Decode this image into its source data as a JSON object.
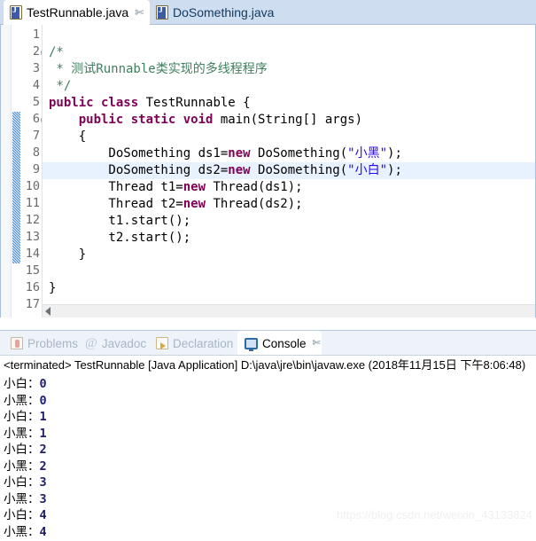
{
  "editor": {
    "tabs": [
      {
        "label": "TestRunnable.java",
        "icon": "java-file-icon",
        "active": true,
        "close": "✄"
      },
      {
        "label": "DoSomething.java",
        "icon": "java-file-icon",
        "active": false,
        "close": ""
      }
    ],
    "close_glyph": "✄",
    "lines": [
      {
        "no": "1",
        "fold": false,
        "changed": false,
        "current": false,
        "segments": []
      },
      {
        "no": "2",
        "fold": true,
        "changed": false,
        "current": false,
        "segments": [
          {
            "t": "/*",
            "c": "cmt"
          }
        ]
      },
      {
        "no": "3",
        "fold": false,
        "changed": false,
        "current": false,
        "segments": [
          {
            "t": " * 测试Runnable类实现的多线程程序",
            "c": "cmt"
          }
        ]
      },
      {
        "no": "4",
        "fold": false,
        "changed": false,
        "current": false,
        "segments": [
          {
            "t": " */",
            "c": "cmt"
          }
        ]
      },
      {
        "no": "5",
        "fold": false,
        "changed": false,
        "current": false,
        "segments": [
          {
            "t": "public class",
            "c": "kw"
          },
          {
            "t": " TestRunnable {",
            "c": ""
          }
        ]
      },
      {
        "no": "6",
        "fold": true,
        "changed": true,
        "current": false,
        "segments": [
          {
            "t": "    ",
            "c": ""
          },
          {
            "t": "public static void",
            "c": "kw"
          },
          {
            "t": " main(String[] args)",
            "c": ""
          }
        ]
      },
      {
        "no": "7",
        "fold": false,
        "changed": true,
        "current": false,
        "segments": [
          {
            "t": "    {",
            "c": ""
          }
        ]
      },
      {
        "no": "8",
        "fold": false,
        "changed": true,
        "current": false,
        "segments": [
          {
            "t": "        DoSomething ds1=",
            "c": ""
          },
          {
            "t": "new",
            "c": "kw"
          },
          {
            "t": " DoSomething(",
            "c": ""
          },
          {
            "t": "\"小黑\"",
            "c": "str"
          },
          {
            "t": ");",
            "c": ""
          }
        ]
      },
      {
        "no": "9",
        "fold": false,
        "changed": true,
        "current": true,
        "segments": [
          {
            "t": "        DoSomething ds2=",
            "c": ""
          },
          {
            "t": "new",
            "c": "kw"
          },
          {
            "t": " DoSomething(",
            "c": ""
          },
          {
            "t": "\"小白\"",
            "c": "str"
          },
          {
            "t": ");",
            "c": ""
          }
        ]
      },
      {
        "no": "10",
        "fold": false,
        "changed": true,
        "current": false,
        "segments": [
          {
            "t": "        Thread t1=",
            "c": ""
          },
          {
            "t": "new",
            "c": "kw"
          },
          {
            "t": " Thread(ds1);",
            "c": ""
          }
        ]
      },
      {
        "no": "11",
        "fold": false,
        "changed": true,
        "current": false,
        "segments": [
          {
            "t": "        Thread t2=",
            "c": ""
          },
          {
            "t": "new",
            "c": "kw"
          },
          {
            "t": " Thread(ds2);",
            "c": ""
          }
        ]
      },
      {
        "no": "12",
        "fold": false,
        "changed": true,
        "current": false,
        "segments": [
          {
            "t": "        t1.start();",
            "c": ""
          }
        ]
      },
      {
        "no": "13",
        "fold": false,
        "changed": true,
        "current": false,
        "segments": [
          {
            "t": "        t2.start();",
            "c": ""
          }
        ]
      },
      {
        "no": "14",
        "fold": false,
        "changed": true,
        "current": false,
        "segments": [
          {
            "t": "    }",
            "c": ""
          }
        ]
      },
      {
        "no": "15",
        "fold": false,
        "changed": false,
        "current": false,
        "segments": []
      },
      {
        "no": "16",
        "fold": false,
        "changed": false,
        "current": false,
        "segments": [
          {
            "t": "}",
            "c": ""
          }
        ]
      },
      {
        "no": "17",
        "fold": false,
        "changed": false,
        "current": false,
        "segments": []
      }
    ]
  },
  "views": {
    "tabs": [
      {
        "label": "Problems",
        "icon": "problems-icon",
        "active": false
      },
      {
        "label": "Javadoc",
        "icon": "javadoc-icon",
        "active": false
      },
      {
        "label": "Declaration",
        "icon": "declaration-icon",
        "active": false
      },
      {
        "label": "Console",
        "icon": "console-icon",
        "active": true
      }
    ],
    "close_glyph": "✄"
  },
  "console": {
    "status": "<terminated> TestRunnable [Java Application] D:\\java\\jre\\bin\\javaw.exe (2018年11月15日 下午8:06:48)",
    "output": [
      {
        "name": "小白",
        "value": "0"
      },
      {
        "name": "小黑",
        "value": "0"
      },
      {
        "name": "小白",
        "value": "1"
      },
      {
        "name": "小黑",
        "value": "1"
      },
      {
        "name": "小白",
        "value": "2"
      },
      {
        "name": "小黑",
        "value": "2"
      },
      {
        "name": "小白",
        "value": "3"
      },
      {
        "name": "小黑",
        "value": "3"
      },
      {
        "name": "小白",
        "value": "4"
      },
      {
        "name": "小黑",
        "value": "4"
      }
    ]
  },
  "watermark": {
    "text": "https://blog.csdn.net/weixin_43133824"
  },
  "colors": {
    "keyword": "#7F0055",
    "comment": "#3F7F5F",
    "string": "#2A00FF",
    "tab_bar": "#CEDEF0",
    "current_line": "#E8F2FE",
    "change_bar": "#4F8FD0"
  }
}
